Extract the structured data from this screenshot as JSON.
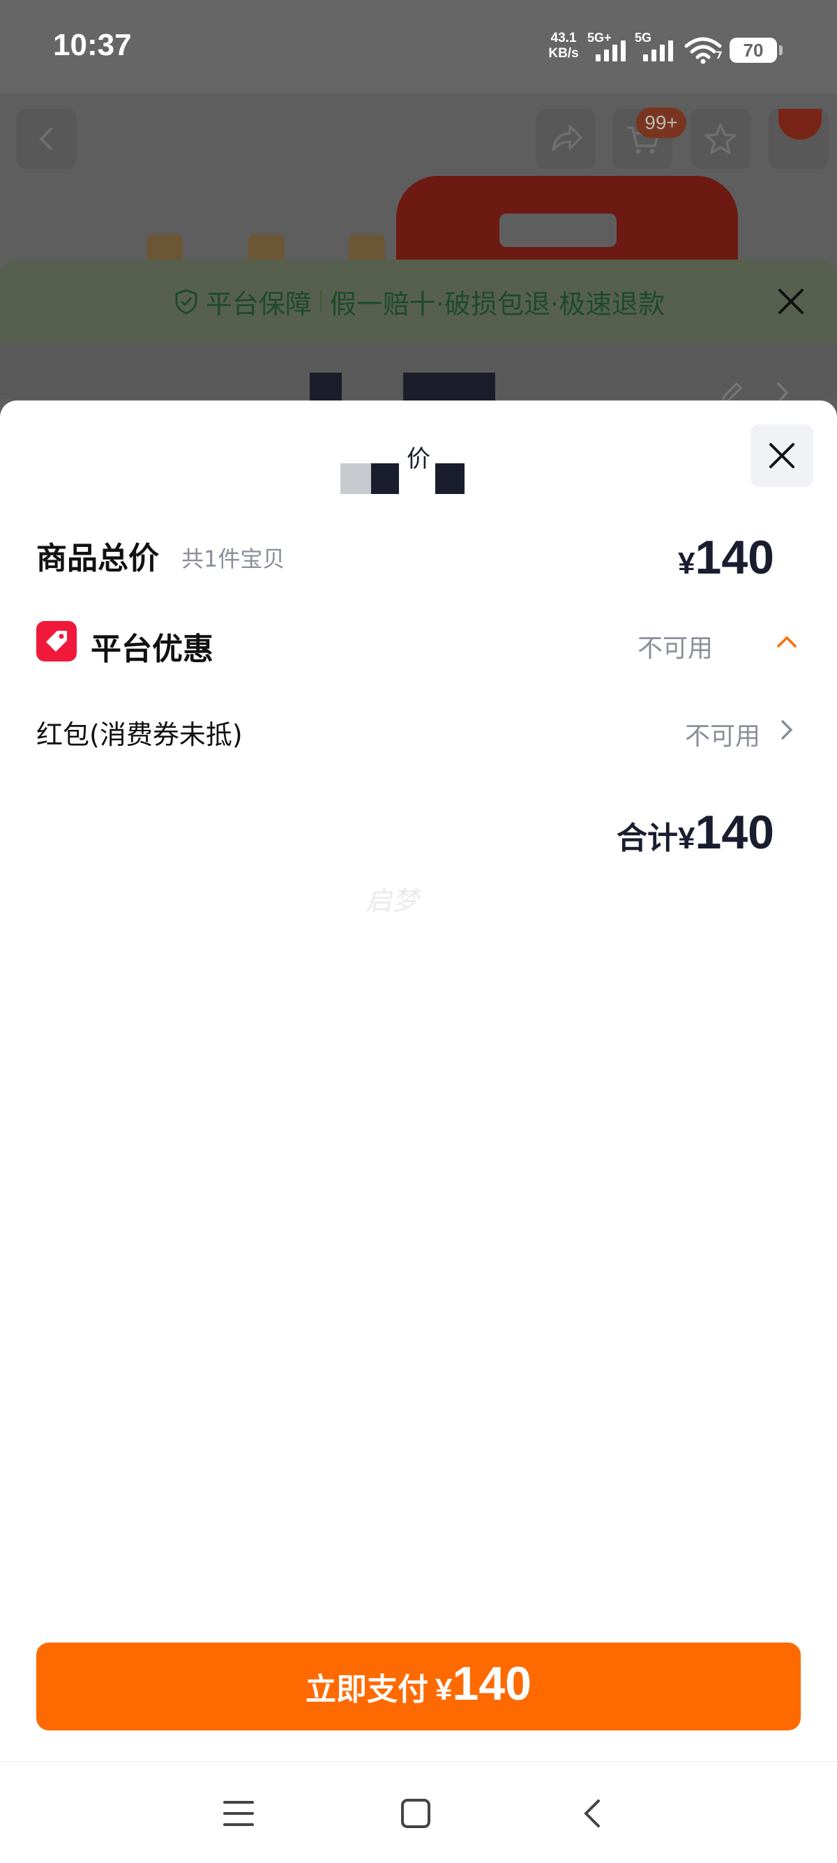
{
  "status_bar": {
    "time": "10:37",
    "net_speed_value": "43.1",
    "net_speed_unit": "KB/s",
    "sim1_label": "5G+",
    "sim2_label": "5G",
    "wifi_label": "7",
    "battery": "70"
  },
  "background_page": {
    "cart_badge": "99+",
    "guarantee_brand": "平台保障",
    "guarantee_text": "假一赔十·破损包退·极速退款"
  },
  "sheet": {
    "title": "价",
    "total_label": "商品总价",
    "total_count": "共1件宝贝",
    "currency": "¥",
    "total_value": "140",
    "promo_label": "平台优惠",
    "promo_status": "不可用",
    "hongbao_label": "红包(消费券未抵)",
    "hongbao_status": "不可用",
    "sum_label": "合计",
    "sum_value": "140",
    "watermark": "启梦"
  },
  "pay_button": {
    "label": "立即支付",
    "currency": "¥",
    "value": "140"
  },
  "colors": {
    "accent": "#ff6a00",
    "promo_icon": "#f0193b",
    "muted_text": "#8a8f99"
  },
  "icons": {
    "back": "chevron-left-icon",
    "share": "share-icon",
    "cart": "cart-icon",
    "favorite": "star-icon",
    "message": "message-icon",
    "guarantee": "shield-check-icon",
    "close": "close-icon",
    "edit": "pencil-icon",
    "promo": "tag-icon",
    "collapse": "chevron-up-icon",
    "more": "chevron-right-icon",
    "nav_menu": "menu-icon",
    "nav_home": "square-icon",
    "nav_back": "chevron-left-icon"
  }
}
